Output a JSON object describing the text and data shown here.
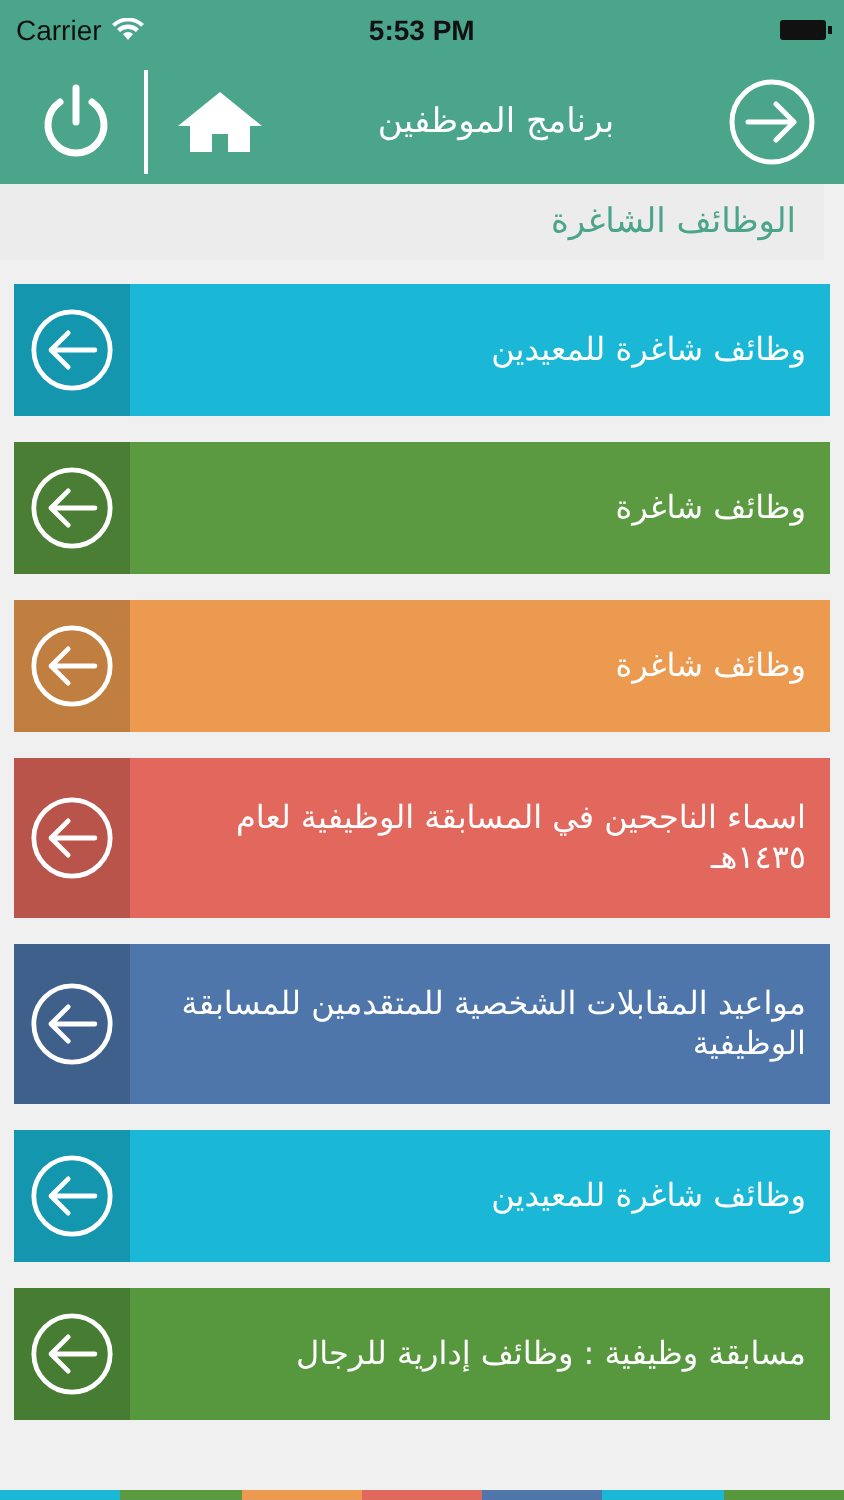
{
  "status_bar": {
    "carrier": "Carrier",
    "time": "5:53 PM"
  },
  "header": {
    "title": "برنامج الموظفين"
  },
  "section": {
    "title": "الوظائف الشاغرة"
  },
  "items": [
    {
      "label": "وظائف شاغرة للمعيدين",
      "color": "#1ab8d6"
    },
    {
      "label": "وظائف شاغرة",
      "color": "#5b9a41"
    },
    {
      "label": "وظائف شاغرة",
      "color": "#eb9a50"
    },
    {
      "label": "اسماء الناجحين في المسابقة الوظيفية لعام ١٤٣٥هـ",
      "color": "#e2675c"
    },
    {
      "label": "مواعيد المقابلات الشخصية للمتقدمين للمسابقة الوظيفية",
      "color": "#4f76ab"
    },
    {
      "label": "وظائف شاغرة للمعيدين",
      "color": "#1ab8d6"
    },
    {
      "label": "مسابقة وظيفية : وظائف إدارية للرجال",
      "color": "#57983f"
    }
  ]
}
